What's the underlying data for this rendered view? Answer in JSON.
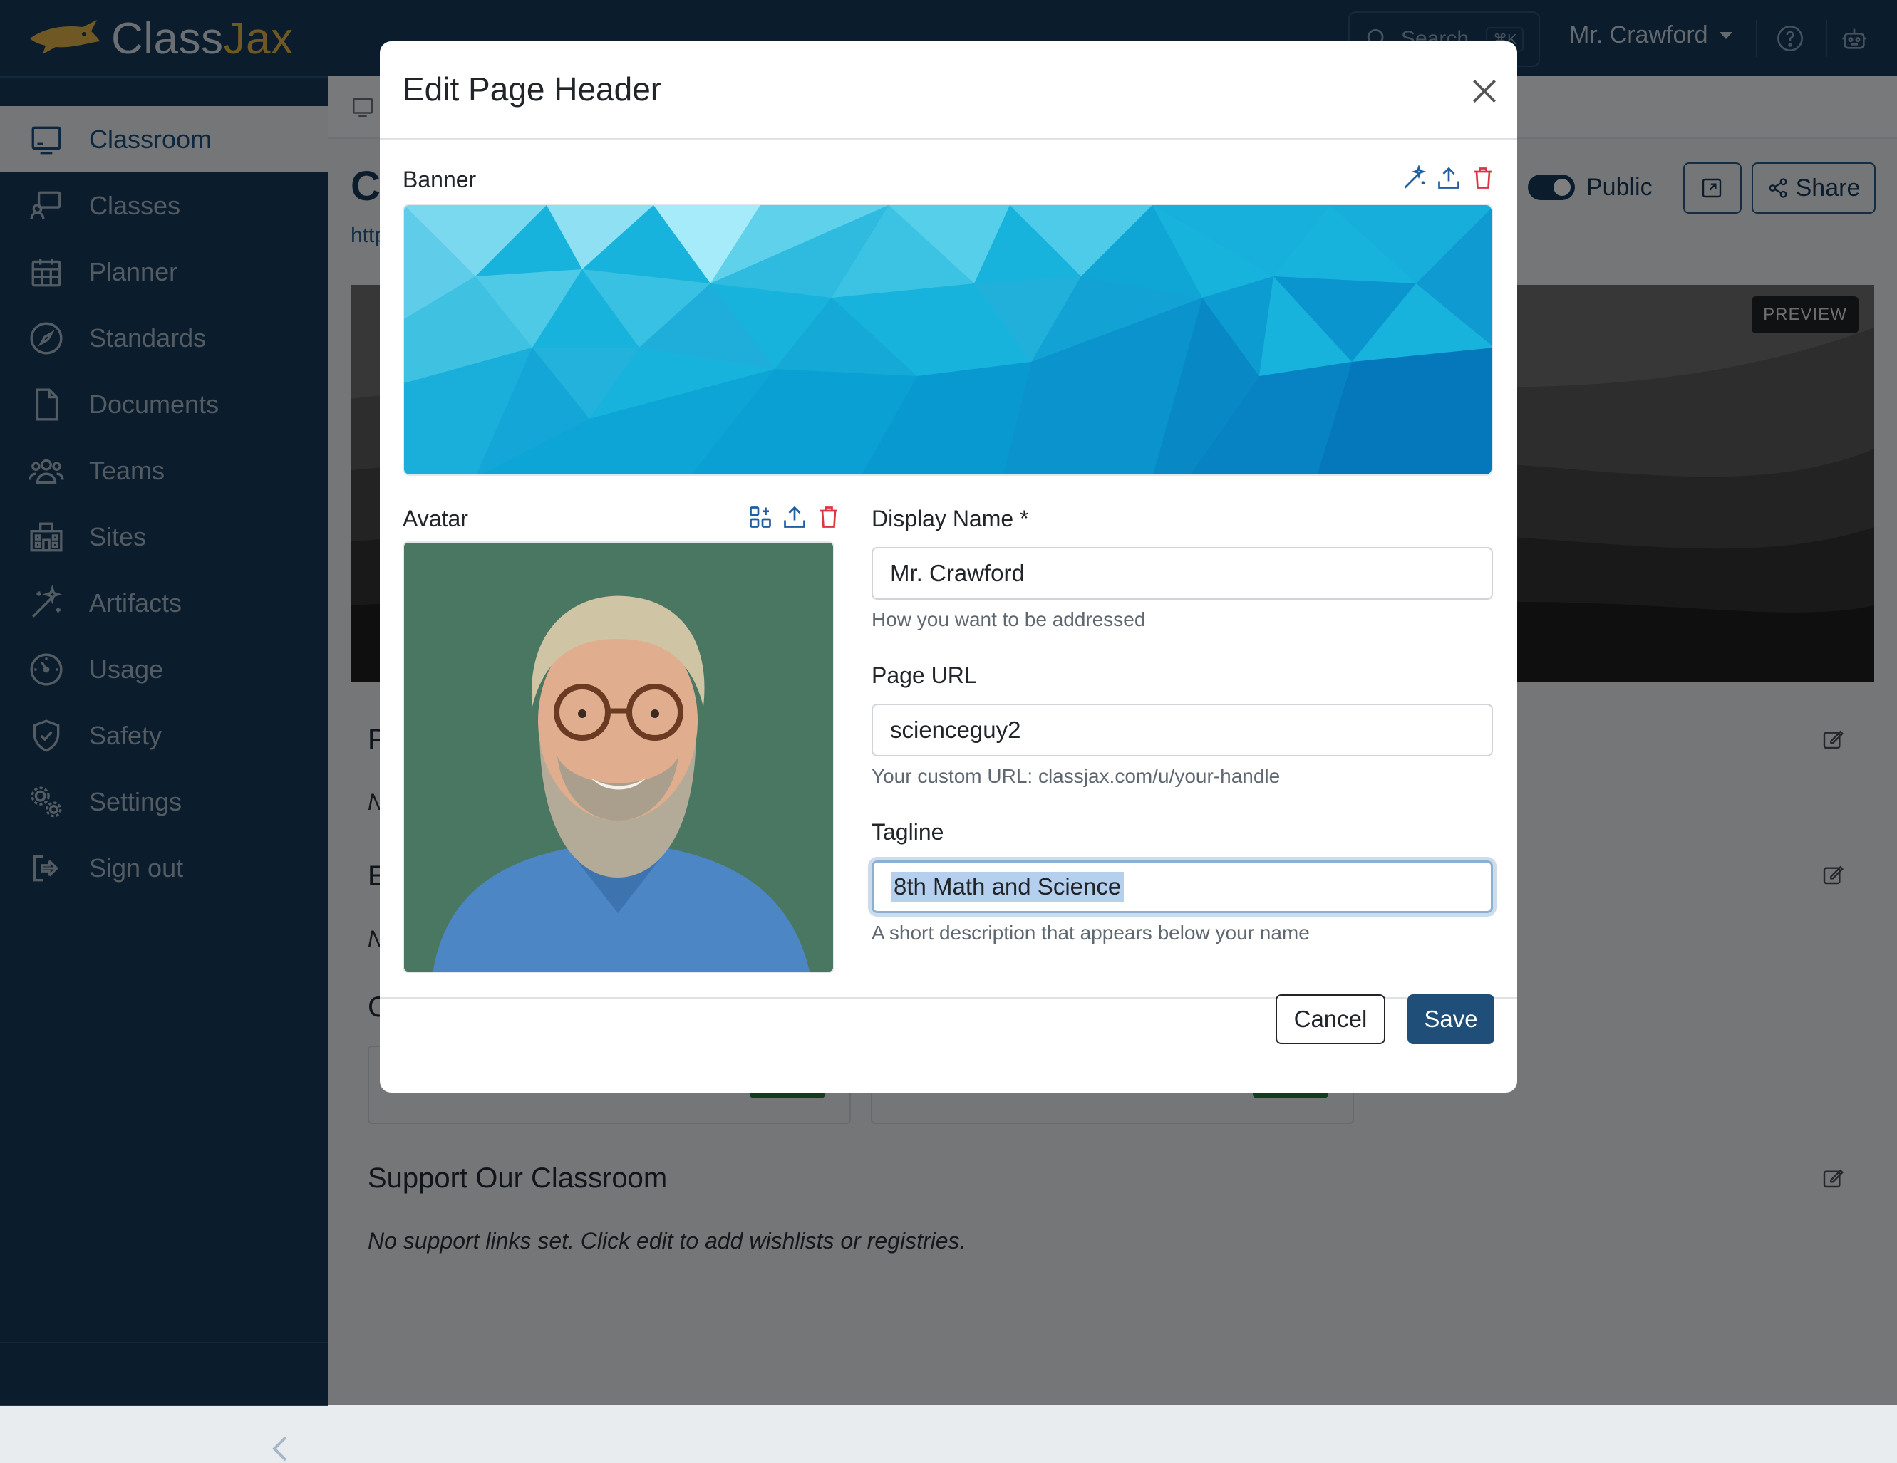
{
  "app": {
    "brand_part1": "Class",
    "brand_part2": "Jax"
  },
  "topbar": {
    "search_label": "Search",
    "search_shortcut": "⌘K",
    "user_name": "Mr. Crawford",
    "icons": [
      "search-icon",
      "help-icon",
      "robot-icon"
    ]
  },
  "sidebar": {
    "items": [
      {
        "label": "Classroom",
        "icon": "monitor-icon",
        "active": true
      },
      {
        "label": "Classes",
        "icon": "presentation-icon"
      },
      {
        "label": "Planner",
        "icon": "calendar-icon"
      },
      {
        "label": "Standards",
        "icon": "compass-icon"
      },
      {
        "label": "Documents",
        "icon": "file-icon"
      },
      {
        "label": "Teams",
        "icon": "users-icon"
      },
      {
        "label": "Sites",
        "icon": "building-icon"
      },
      {
        "label": "Artifacts",
        "icon": "magic-wand-icon"
      },
      {
        "label": "Usage",
        "icon": "speedometer-icon"
      },
      {
        "label": "Safety",
        "icon": "shield-check-icon"
      },
      {
        "label": "Settings",
        "icon": "gears-icon"
      },
      {
        "label": "Sign out",
        "icon": "sign-out-icon"
      }
    ]
  },
  "background": {
    "title_initial": "C",
    "url_fragment": "http",
    "public_label": "Public",
    "share_label": "Share",
    "preview_badge": "PREVIEW",
    "section_initials": [
      "P",
      "E",
      "C"
    ],
    "line_initials": [
      "N",
      "N"
    ],
    "support_title": "Support Our Classroom",
    "support_text": "No support links set. Click edit to add wishlists or registries."
  },
  "modal": {
    "title": "Edit Page Header",
    "banner_label": "Banner",
    "avatar_label": "Avatar",
    "display_name": {
      "label": "Display Name *",
      "value": "Mr. Crawford",
      "help": "How you want to be addressed"
    },
    "page_url": {
      "label": "Page URL",
      "value": "scienceguy2",
      "help": "Your custom URL: classjax.com/u/your-handle"
    },
    "tagline": {
      "label": "Tagline",
      "value": "8th Math and Science",
      "help": "A short description that appears below your name"
    },
    "cancel_label": "Cancel",
    "save_label": "Save"
  },
  "colors": {
    "navy": "#173a5a",
    "accent_gold": "#e0b14a",
    "save_button": "#1f4f78",
    "delete_red": "#dc3545",
    "active_item": "#1c4f80"
  }
}
